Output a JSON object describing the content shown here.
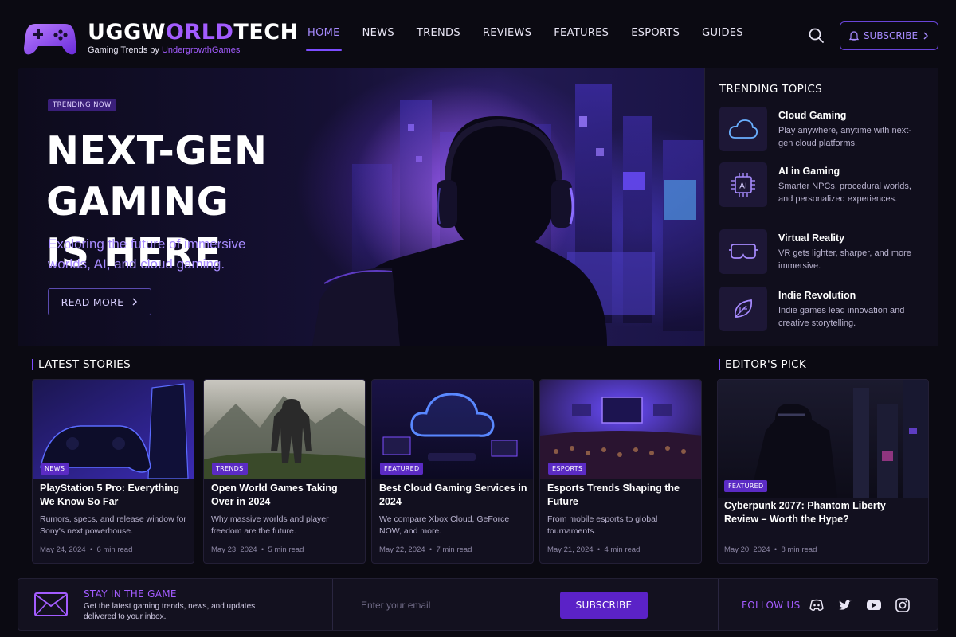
{
  "header": {
    "brand_part1": "UGGW",
    "brand_part2": "ORLD",
    "brand_part3": "TECH",
    "tagline_prefix": "Gaming Trends by ",
    "tagline_highlight": "UndergrowthGames",
    "nav": [
      {
        "label": "HOME",
        "active": true
      },
      {
        "label": "NEWS"
      },
      {
        "label": "TRENDS"
      },
      {
        "label": "REVIEWS"
      },
      {
        "label": "FEATURES"
      },
      {
        "label": "ESPORTS"
      },
      {
        "label": "GUIDES"
      }
    ],
    "subscribe_label": "SUBSCRIBE"
  },
  "hero": {
    "badge": "TRENDING NOW",
    "title_line1": "NEXT-GEN GAMING",
    "title_line2": "IS HERE",
    "subtitle": "Exploring the future of immersive worlds, AI, and cloud gaming.",
    "cta": "READ MORE"
  },
  "trending": {
    "title": "TRENDING TOPICS",
    "topics": [
      {
        "title": "Cloud Gaming",
        "desc": "Play anywhere, anytime with next-gen cloud platforms.",
        "icon": "cloud-icon"
      },
      {
        "title": "AI in Gaming",
        "desc": "Smarter NPCs, procedural worlds, and personalized experiences.",
        "icon": "ai-chip-icon"
      },
      {
        "title": "Virtual Reality",
        "desc": "VR gets lighter, sharper, and more immersive.",
        "icon": "vr-headset-icon"
      },
      {
        "title": "Indie Revolution",
        "desc": "Indie games lead innovation and creative storytelling.",
        "icon": "leaf-icon"
      }
    ]
  },
  "latest": {
    "title": "LATEST STORIES",
    "cards": [
      {
        "badge": "NEWS",
        "title": "PlayStation 5 Pro: Everything We Know So Far",
        "desc": "Rumors, specs, and release window for Sony's next powerhouse.",
        "date": "May 24, 2024",
        "read": "6 min read"
      },
      {
        "badge": "TRENDS",
        "title": "Open World Games Taking Over in 2024",
        "desc": "Why massive worlds and player freedom are the future.",
        "date": "May 23, 2024",
        "read": "5 min read"
      },
      {
        "badge": "FEATURED",
        "title": "Best Cloud Gaming Services in 2024",
        "desc": "We compare Xbox Cloud, GeForce NOW, and more.",
        "date": "May 22, 2024",
        "read": "7 min read"
      },
      {
        "badge": "ESPORTS",
        "title": "Esports Trends Shaping the Future",
        "desc": "From mobile esports to global tournaments.",
        "date": "May 21, 2024",
        "read": "4 min read"
      }
    ]
  },
  "editor": {
    "title": "EDITOR'S PICK",
    "badge": "FEATURED",
    "card_title": "Cyberpunk 2077: Phantom Liberty Review – Worth the Hype?",
    "date": "May 20, 2024",
    "read": "8 min read"
  },
  "newsletter": {
    "title": "STAY IN THE GAME",
    "desc": "Get the latest gaming trends, news, and updates delivered to your inbox.",
    "placeholder": "Enter your email",
    "button": "SUBSCRIBE",
    "follow": "FOLLOW US",
    "social": [
      "discord-icon",
      "twitter-icon",
      "youtube-icon",
      "instagram-icon"
    ]
  },
  "colors": {
    "accent": "#7c4dff",
    "accent_text": "#a35cff",
    "background": "#0b0a12",
    "panel": "#12101f"
  }
}
